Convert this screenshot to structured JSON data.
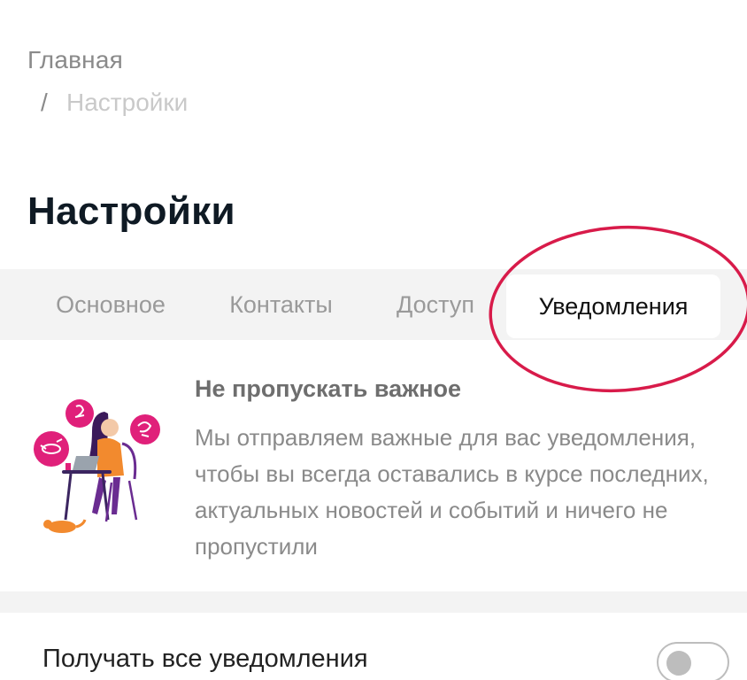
{
  "breadcrumb": {
    "home": "Главная",
    "separator": "/",
    "current": "Настройки"
  },
  "page": {
    "title": "Настройки"
  },
  "tabs": [
    {
      "label": "Основное",
      "active": false
    },
    {
      "label": "Контакты",
      "active": false
    },
    {
      "label": "Доступ",
      "active": false
    },
    {
      "label": "Уведомления",
      "active": true
    }
  ],
  "info": {
    "title": "Не пропускать важное",
    "text": "Мы отправляем важные для вас уведомления, чтобы вы всегда оставались в курсе последних, актуальных новостей и событий и ничего не пропустили",
    "illustration_icon": "woman-with-laptop-notifications-illustration"
  },
  "settings": {
    "all_notifications_label": "Получать все уведомления",
    "all_notifications_enabled": false
  },
  "colors": {
    "highlight_ring": "#d81b4a",
    "accent_pink": "#e0207a",
    "accent_purple": "#6a2c91"
  }
}
